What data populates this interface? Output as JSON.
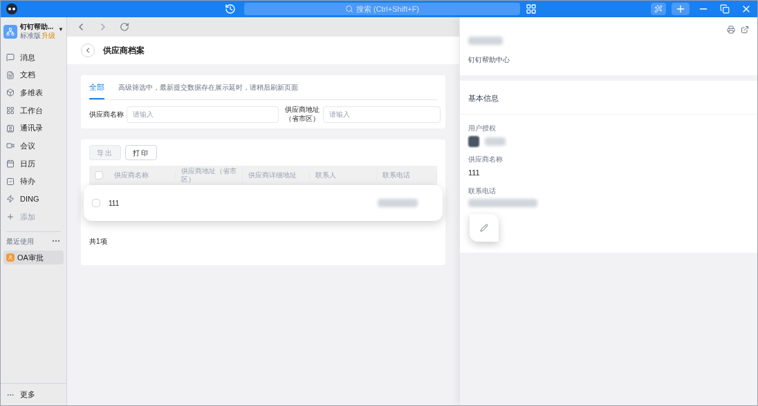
{
  "titlebar": {
    "search_placeholder": "搜索 (Ctrl+Shift+F)"
  },
  "org": {
    "name": "钉钉帮助...",
    "caret": "▼",
    "edition": "标准版",
    "upgrade": "升级"
  },
  "sidebar": {
    "items": [
      {
        "label": "消息",
        "kind": "message",
        "disabled": false
      },
      {
        "label": "文档",
        "kind": "doc",
        "disabled": false
      },
      {
        "label": "多维表",
        "kind": "table",
        "disabled": false
      },
      {
        "label": "工作台",
        "kind": "grid",
        "disabled": false
      },
      {
        "label": "通讯录",
        "kind": "contacts",
        "disabled": false
      },
      {
        "label": "会议",
        "kind": "meeting",
        "disabled": false
      },
      {
        "label": "日历",
        "kind": "calendar",
        "disabled": false
      },
      {
        "label": "待办",
        "kind": "todo",
        "disabled": false
      },
      {
        "label": "DING",
        "kind": "ding",
        "disabled": false
      },
      {
        "label": "添加",
        "kind": "add",
        "disabled": true
      }
    ],
    "recent_title": "最近使用",
    "recent": [
      {
        "label": "OA审批",
        "selected": true
      }
    ],
    "more": "更多"
  },
  "page": {
    "title": "供应商档案",
    "tabs": [
      {
        "label": "全部",
        "selected": true
      }
    ],
    "notice": "高级筛选中，最新提交数据存在展示延时，请稍后刷新页面",
    "filters": [
      {
        "label": "供应商名称",
        "placeholder": "请输入"
      },
      {
        "label": "供应商地址（省市区）",
        "placeholder": "请输入"
      }
    ],
    "buttons": [
      {
        "label": "导出",
        "disabled": true
      },
      {
        "label": "打印",
        "disabled": false
      }
    ],
    "table": {
      "columns": [
        "供应商名称",
        "供应商地址（省市区）",
        "供应商详细地址",
        "联系人",
        "联系电话"
      ],
      "header_checked": false,
      "rows": [
        {
          "cells": [
            "111"
          ],
          "checked": false
        }
      ]
    },
    "total": "共1项"
  },
  "detail": {
    "org": "钉钉帮助中心",
    "section": "基本信息",
    "fields": [
      {
        "label": "用户授权",
        "kind": "user"
      },
      {
        "label": "供应商名称",
        "kind": "text",
        "value": "111"
      },
      {
        "label": "联系电话",
        "kind": "phone"
      }
    ]
  }
}
